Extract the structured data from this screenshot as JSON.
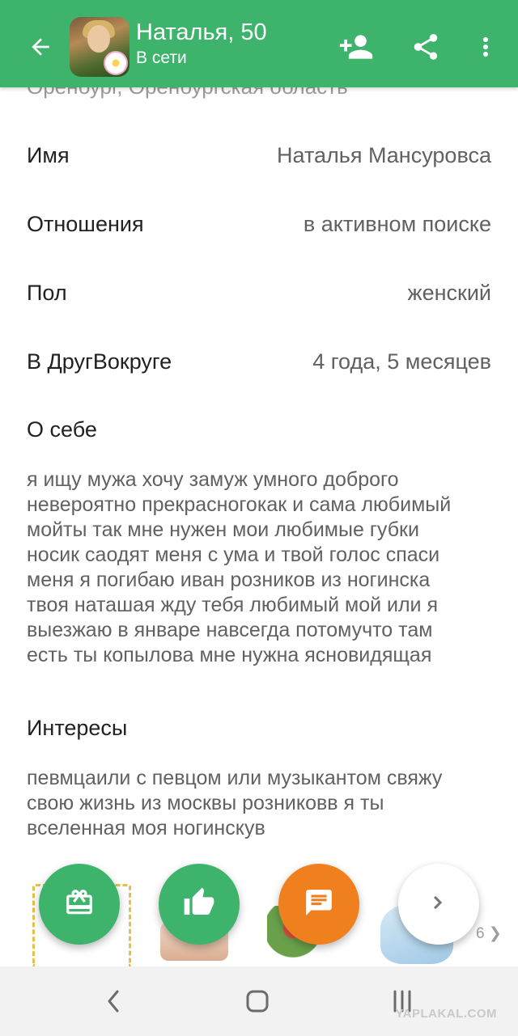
{
  "header": {
    "title": "Наталья, 50",
    "subtitle": "В сети",
    "back_icon": "arrow-back-icon",
    "add_friend_icon": "person-add-icon",
    "share_icon": "share-icon",
    "more_icon": "more-vert-icon",
    "color": "#3db36b"
  },
  "cut_off_text": "Оренбург, Оренбургская область",
  "profile": {
    "rows": [
      {
        "label": "Имя",
        "value": "Наталья Мансуровса"
      },
      {
        "label": "Отношения",
        "value": "в активном поиске"
      },
      {
        "label": "Пол",
        "value": "женский"
      },
      {
        "label": "В ДругВокруге",
        "value": "4 года, 5 месяцев"
      }
    ],
    "about_title": "О себе",
    "about_lines": [
      "я ищу мужа хочу замуж умного доброго",
      "невероятно прекрасногокак и сама любимый",
      "мойты так мне нужен мои любимые губки",
      "носик саодят меня с ума и твой голос спаси",
      "меня я погибаю иван розников из ногинска",
      "твоя наташая жду тебя любимый мой или я",
      "выезжаю в январе навсегда потомучто там",
      "есть ты копылова мне нужна ясновидящая"
    ],
    "interests_title": "Интересы",
    "interests_lines": [
      "певмцаили с певцом или музыкантом свяжу",
      "свою жизнь из москвы розниковв я ты",
      "вселенная моя ногинскув"
    ]
  },
  "gifts": {
    "count_label": "6 ❯"
  },
  "actions": {
    "gift_icon": "gift-icon",
    "like_icon": "thumbs-up-icon",
    "message_icon": "message-icon",
    "next_icon": "chevron-right-icon",
    "orange": "#f07f1e"
  },
  "system_nav": {
    "back_icon": "nav-back-icon",
    "home_icon": "nav-home-icon",
    "recents_icon": "nav-recents-icon",
    "watermark": "YAPLAKAL.COM"
  }
}
